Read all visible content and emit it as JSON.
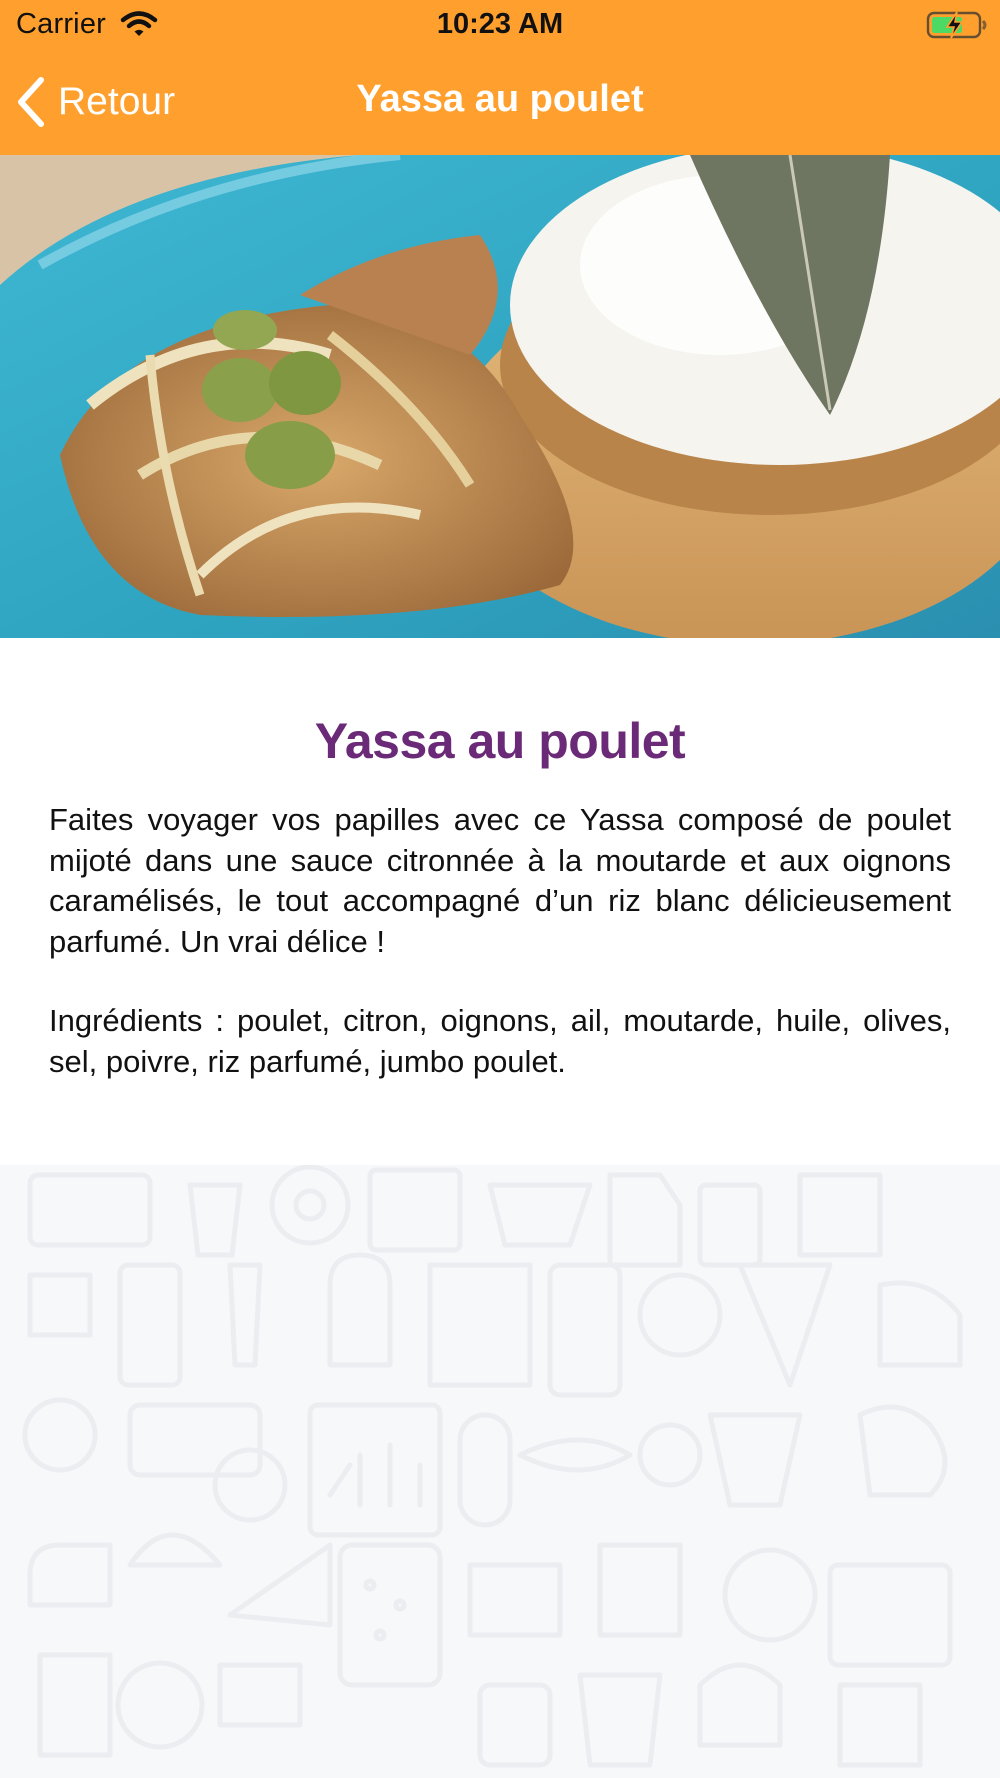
{
  "status_bar": {
    "carrier": "Carrier",
    "time": "10:23 AM"
  },
  "nav": {
    "back_label": "Retour",
    "title": "Yassa au poulet"
  },
  "recipe": {
    "image_icon": "dish-photo",
    "title": "Yassa au poulet",
    "description": "Faites voyager vos papilles avec ce Yassa composé de poulet mijoté dans une sauce citronnée à la moutarde et aux oignons caramélisés, le tout accompagné d’un riz blanc délicieusement parfumé. Un vrai délice !",
    "ingredients": "Ingrédients : poulet, citron, oignons, ail, moutarde, huile, olives, sel, poivre, riz parfumé, jumbo poulet."
  },
  "colors": {
    "nav_bar": "#ffa02e",
    "title": "#6b2a77",
    "plate": "#36aac6",
    "background": "#f7f8fa"
  }
}
